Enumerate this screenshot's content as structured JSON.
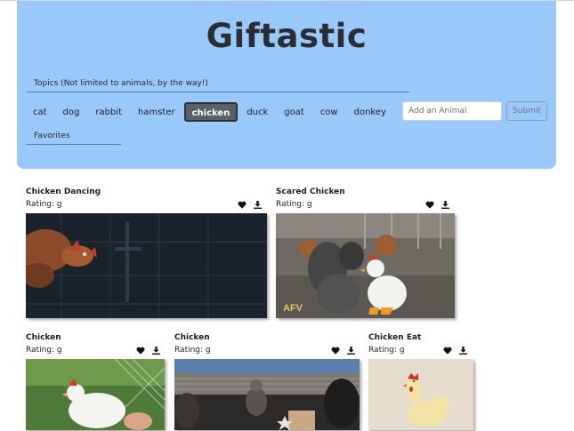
{
  "header": {
    "title": "Giftastic",
    "topics_label": "Topics (Not limited to animals, by the way!)",
    "favorites_label": "Favorites",
    "background_color": "#99c8fa"
  },
  "topics": [
    {
      "label": "cat",
      "active": false
    },
    {
      "label": "dog",
      "active": false
    },
    {
      "label": "rabbit",
      "active": false
    },
    {
      "label": "hamster",
      "active": false
    },
    {
      "label": "chicken",
      "active": true
    },
    {
      "label": "duck",
      "active": false
    },
    {
      "label": "goat",
      "active": false
    },
    {
      "label": "cow",
      "active": false
    },
    {
      "label": "donkey",
      "active": false
    }
  ],
  "add_form": {
    "input_value": "",
    "input_placeholder": "Add an Animal",
    "submit_label": "Submit"
  },
  "gifs": [
    {
      "title": "Chicken Dancing",
      "rating": "Rating: g",
      "icons": [
        "heart-icon",
        "download-icon"
      ]
    },
    {
      "title": "Scared Chicken",
      "rating": "Rating: g",
      "icons": [
        "heart-icon",
        "download-icon"
      ]
    },
    {
      "title": "Chicken",
      "rating": "Rating: g",
      "icons": [
        "heart-icon",
        "download-icon"
      ]
    },
    {
      "title": "Chicken",
      "rating": "Rating: g",
      "icons": [
        "heart-icon",
        "download-icon"
      ]
    },
    {
      "title": "Chicken Eat",
      "rating": "Rating: g",
      "icons": [
        "heart-icon",
        "download-icon"
      ]
    }
  ]
}
